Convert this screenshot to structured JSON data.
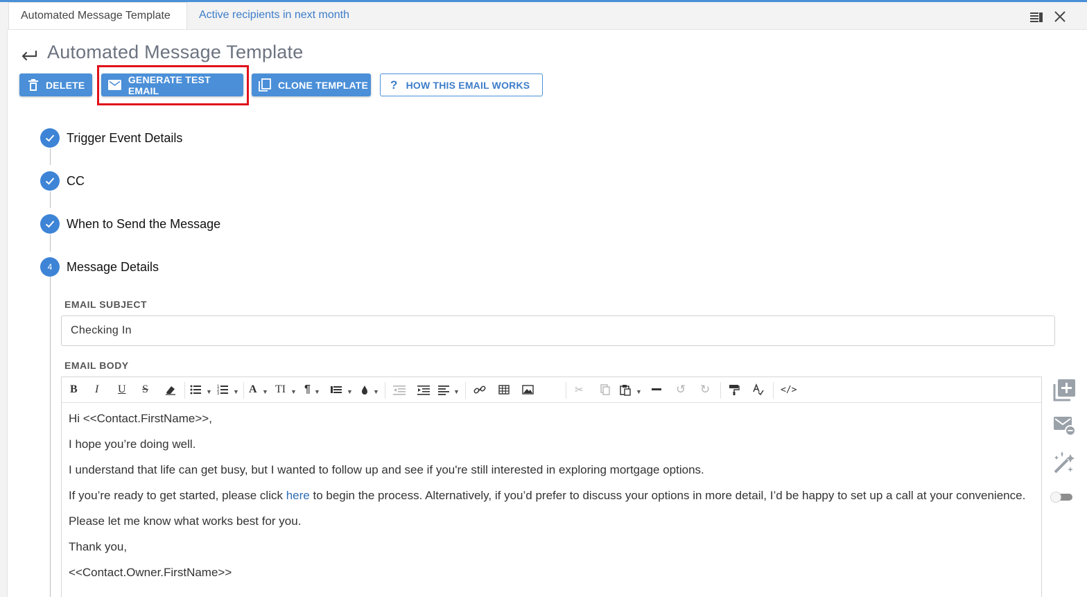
{
  "tabs": [
    {
      "label": "Automated Message Template",
      "active": true
    },
    {
      "label": "Active recipients in next month",
      "active": false
    }
  ],
  "page": {
    "title": "Automated Message Template"
  },
  "actions": {
    "delete": "DELETE",
    "generate": "GENERATE TEST EMAIL",
    "clone": "CLONE TEMPLATE",
    "how": "HOW THIS EMAIL WORKS"
  },
  "steps": [
    {
      "label": "Trigger Event Details",
      "status": "done"
    },
    {
      "label": "CC",
      "status": "done"
    },
    {
      "label": "When to Send the Message",
      "status": "done"
    },
    {
      "label": "Message Details",
      "status": "active",
      "number": "4"
    }
  ],
  "form": {
    "subject_label": "EMAIL SUBJECT",
    "subject_value": "Checking In",
    "body_label": "EMAIL BODY"
  },
  "email_body": {
    "p1": "Hi <<Contact.FirstName>>,",
    "p2": "I hope you’re doing well.",
    "p3": "I understand that life can get busy, but I wanted to follow up and see if you're still interested in exploring mortgage options.",
    "p4_before": "If you’re ready to get started, please click ",
    "p4_link": "here",
    "p4_after": " to begin the process. Alternatively, if you’d prefer to discuss your options in more detail, I’d be happy to set up a call at your convenience.",
    "p5": "Please let me know what works best for you.",
    "p6": "Thank you,",
    "p7": "<<Contact.Owner.FirstName>>"
  },
  "colors": {
    "accent": "#4a8fd8",
    "highlight": "#e0101a",
    "link": "#2f6db5"
  },
  "icons": [
    "trash-icon",
    "mail-icon",
    "copy-icon",
    "question-icon",
    "check-icon",
    "back-arrow-icon",
    "split-view-icon",
    "close-icon",
    "add-field-icon",
    "mail-remove-icon",
    "magic-wand-icon",
    "toggle-switch"
  ]
}
